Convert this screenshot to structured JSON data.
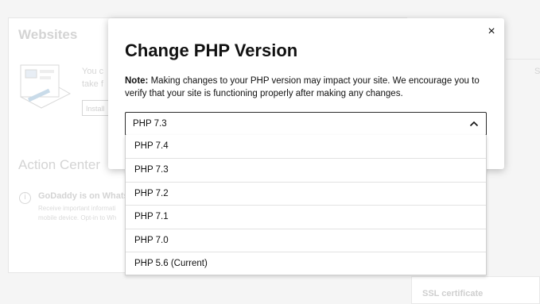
{
  "background": {
    "websites_title": "Websites",
    "intro_line1": "You c",
    "intro_line2": "take f",
    "install_label": "Install",
    "action_center_title": "Action Center",
    "alert_title": "GoDaddy is on Whats",
    "alert_line1": "Receive important informati",
    "alert_line2": "mobile device. Opt-in to Wh",
    "ssl_label": "SSL certificate",
    "right_edge_text": "S"
  },
  "modal": {
    "title": "Change PHP Version",
    "note_label": "Note:",
    "note_text": "Making changes to your PHP version may impact your site. We encourage you to verify that your site is functioning properly after making any changes.",
    "close_symbol": "×",
    "select": {
      "selected_value": "PHP 7.3",
      "options": [
        "PHP 7.4",
        "PHP 7.3",
        "PHP 7.2",
        "PHP 7.1",
        "PHP 7.0",
        "PHP 5.6 (Current)"
      ]
    }
  },
  "icons": {
    "close": "close-icon",
    "chevron": "chevron-up-icon",
    "info": "info-icon"
  }
}
